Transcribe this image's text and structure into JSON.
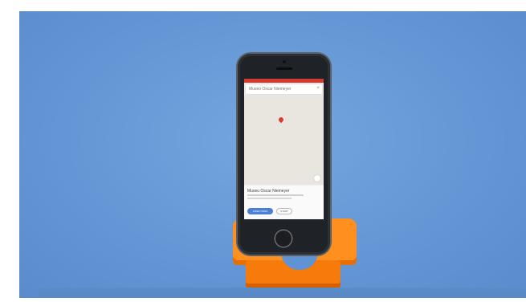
{
  "phone_screen": {
    "search_text": "Museo Oscar Niemeyer",
    "close_glyph": "×",
    "place_title": "Museu Oscar Niemeyer",
    "directions_label": "DIRECTIONS",
    "start_label": "START"
  },
  "colors": {
    "background": "#6597d6",
    "stand": "#ff8f1f",
    "phone_body": "#1f2226",
    "map_pin": "#e03a2e",
    "directions_button": "#4a7fd8"
  }
}
